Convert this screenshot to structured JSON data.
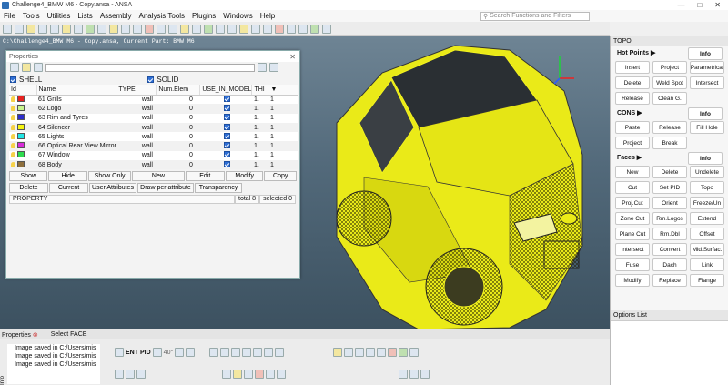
{
  "window": {
    "title": "Challenge4_BMW M6 - Copy.ansa - ANSA"
  },
  "menu": [
    "File",
    "Tools",
    "Utilities",
    "Lists",
    "Assembly",
    "Analysis Tools",
    "Plugins",
    "Windows",
    "Help"
  ],
  "search": {
    "placeholder": "Search Functions and Filters"
  },
  "viewport": {
    "info": "C:\\Challenge4_BMW M6 - Copy.ansa,  Current Part: BMW M6"
  },
  "properties": {
    "title": "Properties",
    "shell_label": "SHELL",
    "solid_label": "SOLID",
    "columns": [
      "Id",
      "Name",
      "TYPE",
      "Num.Elem",
      "USE_IN_MODEL",
      "THI"
    ],
    "rows": [
      {
        "id": "61",
        "name": "Grills",
        "type": "wall",
        "num": "0",
        "thi": "1.",
        "extra": "1",
        "color": "#e8211f"
      },
      {
        "id": "62",
        "name": "Logo",
        "type": "wall",
        "num": "0",
        "thi": "1.",
        "extra": "1",
        "color": "#c9f58e"
      },
      {
        "id": "63",
        "name": "Rim and Tyres",
        "type": "wall",
        "num": "0",
        "thi": "1.",
        "extra": "1",
        "color": "#2d2dcc"
      },
      {
        "id": "64",
        "name": "Silencer",
        "type": "wall",
        "num": "0",
        "thi": "1.",
        "extra": "1",
        "color": "#f5f511"
      },
      {
        "id": "65",
        "name": "Lights",
        "type": "wall",
        "num": "0",
        "thi": "1.",
        "extra": "1",
        "color": "#22e5e5"
      },
      {
        "id": "66",
        "name": "Optical Rear View Mirror",
        "type": "wall",
        "num": "0",
        "thi": "1.",
        "extra": "1",
        "color": "#d92cd9"
      },
      {
        "id": "67",
        "name": "Window",
        "type": "wall",
        "num": "0",
        "thi": "1.",
        "extra": "1",
        "color": "#2fdc4f"
      },
      {
        "id": "68",
        "name": "Body",
        "type": "wall",
        "num": "0",
        "thi": "1.",
        "extra": "1",
        "color": "#8e6f3c"
      }
    ],
    "buttons1": [
      "Show",
      "Hide",
      "Show Only",
      "New",
      "Edit",
      "Modify",
      "Copy"
    ],
    "buttons2": [
      "Delete",
      "Current",
      "User Attributes",
      "Draw per attribute",
      "Transparency"
    ],
    "status": {
      "mode": "PROPERTY",
      "total": "total 8",
      "selected": "selected 0"
    }
  },
  "topo": {
    "title": "TOPO",
    "hotpoints": {
      "label": "Hot Points",
      "info": "Info",
      "buttons": [
        "Insert",
        "Project",
        "Parametrical",
        "Delete",
        "Weld Spot",
        "Intersect",
        "Release",
        "Clean G."
      ]
    },
    "cons": {
      "label": "CONS",
      "info": "Info",
      "buttons": [
        "Paste",
        "Release",
        "Fill Hole",
        "Project",
        "Break"
      ]
    },
    "faces": {
      "label": "Faces",
      "info": "Info",
      "buttons": [
        "New",
        "Delete",
        "Undelete",
        "Cut",
        "Set PID",
        "Topo",
        "Proj.Cut",
        "Orient",
        "Freeze/Un",
        "Zone Cut",
        "Rm.Logos",
        "Extend",
        "Plane Cut",
        "Rm.Dbl",
        "Offset",
        "Intersect",
        "Convert",
        "Mid.Surfac.",
        "Fuse",
        "Dach",
        "Link",
        "Modify",
        "Replace",
        "Flange"
      ]
    }
  },
  "options_list": {
    "title": "Options List"
  },
  "bottom": {
    "tab_properties": "Properties",
    "tab_select": "Select FACE",
    "log": [
      "Image saved in C:/Users/mis",
      "Image saved in C:/Users/mis",
      "Image saved in C:/Users/mis"
    ],
    "info_label": "Info",
    "angle": "40°",
    "ent": "ENT",
    "pid": "PID"
  }
}
